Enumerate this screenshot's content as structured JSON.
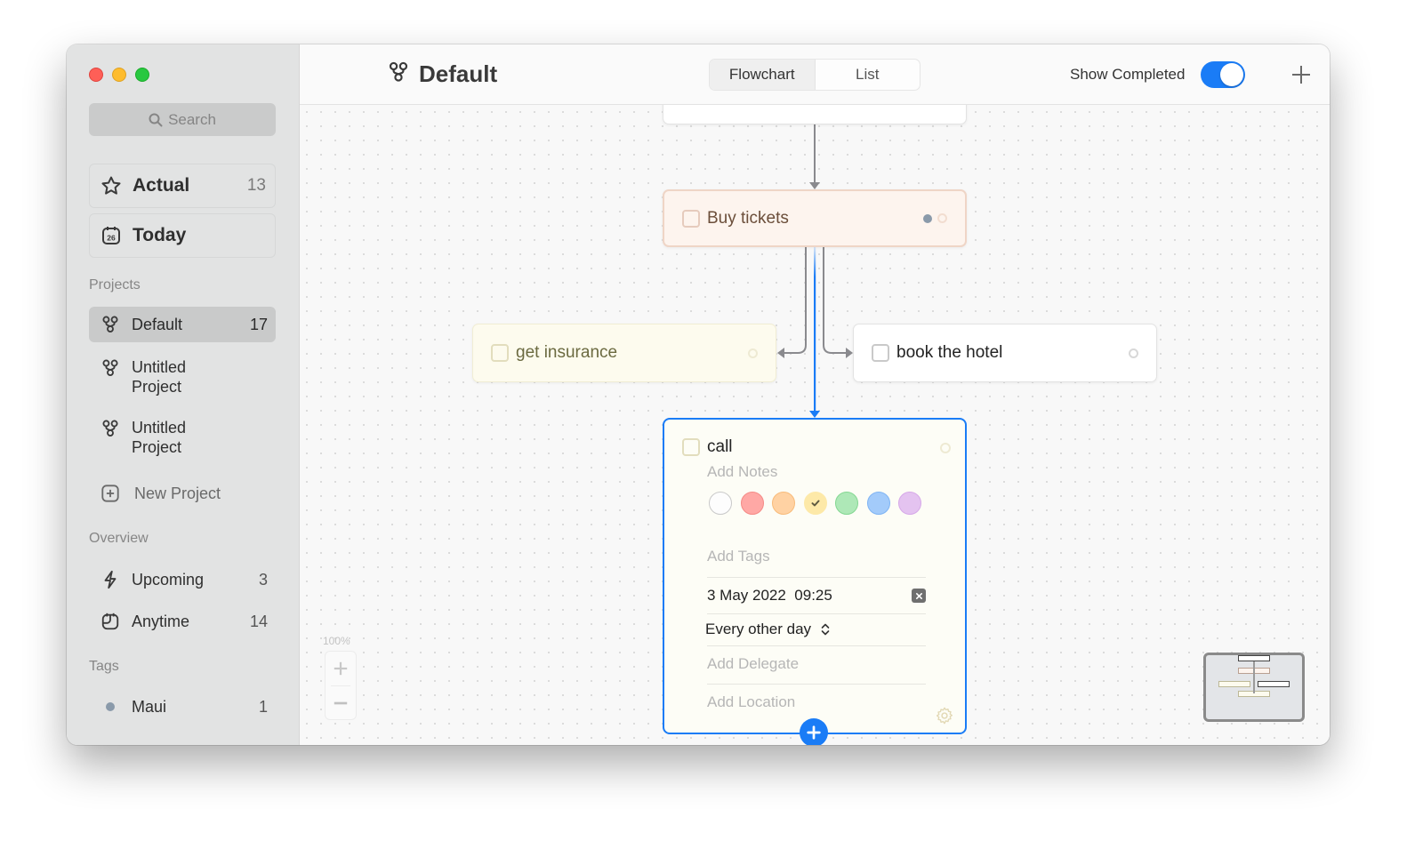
{
  "window": {
    "controls": [
      "close",
      "minimize",
      "zoom"
    ]
  },
  "sidebar": {
    "search_placeholder": "Search",
    "quick": [
      {
        "label": "Actual",
        "count": "13",
        "icon": "star-icon"
      },
      {
        "label": "Today",
        "count": "",
        "icon": "calendar-26-icon",
        "icon_text": "26"
      }
    ],
    "projects_header": "Projects",
    "projects": [
      {
        "label": "Default",
        "count": "17",
        "active": true
      },
      {
        "label": "Untitled\nProject",
        "line1": "Untitled",
        "line2": "Project"
      },
      {
        "label": "Untitled\nProject",
        "line1": "Untitled",
        "line2": "Project"
      }
    ],
    "new_project": "New Project",
    "overview_header": "Overview",
    "overview": [
      {
        "label": "Upcoming",
        "count": "3",
        "icon": "lightning-icon"
      },
      {
        "label": "Anytime",
        "count": "14",
        "icon": "anytime-calendar-icon"
      }
    ],
    "tags_header": "Tags",
    "tags": [
      {
        "label": "Maui",
        "count": "1",
        "color": "#8a9aaa"
      }
    ]
  },
  "toolbar": {
    "title": "Default",
    "view_tabs": [
      {
        "label": "Flowchart",
        "selected": true
      },
      {
        "label": "List",
        "selected": false
      }
    ],
    "show_completed_label": "Show Completed",
    "show_completed": true,
    "accent": "#1a7cf6"
  },
  "canvas": {
    "zoom_level": "100%",
    "nodes": [
      {
        "id": "top",
        "label": ""
      },
      {
        "id": "buy",
        "label": "Buy tickets",
        "color": "#fdf4ee",
        "has_subtasks_indicator": true
      },
      {
        "id": "insurance",
        "label": "get insurance",
        "color": "#fdfbee"
      },
      {
        "id": "hotel",
        "label": "book the hotel",
        "color": "#ffffff"
      }
    ],
    "selected_task": {
      "title": "call",
      "notes_placeholder": "Add Notes",
      "colors": [
        {
          "name": "white",
          "fill": "#fdfdfd",
          "border": "#c9c9c9",
          "selected": false
        },
        {
          "name": "red",
          "fill": "#ffa8a5",
          "border": "#f58a86",
          "selected": false
        },
        {
          "name": "orange",
          "fill": "#ffd2a3",
          "border": "#f8bb7a",
          "selected": false
        },
        {
          "name": "yellow",
          "fill": "#fde9a8",
          "border": "#fde9a8",
          "selected": true
        },
        {
          "name": "green",
          "fill": "#aee8b7",
          "border": "#84d792",
          "selected": false
        },
        {
          "name": "blue",
          "fill": "#a3cbfa",
          "border": "#7fb4f4",
          "selected": false
        },
        {
          "name": "purple",
          "fill": "#e4c3f0",
          "border": "#d6a8e8",
          "selected": false
        }
      ],
      "tags_placeholder": "Add Tags",
      "date": "3 May 2022  09:25",
      "repeat": "Every other day",
      "delegate_placeholder": "Add Delegate",
      "location_placeholder": "Add Location"
    }
  }
}
